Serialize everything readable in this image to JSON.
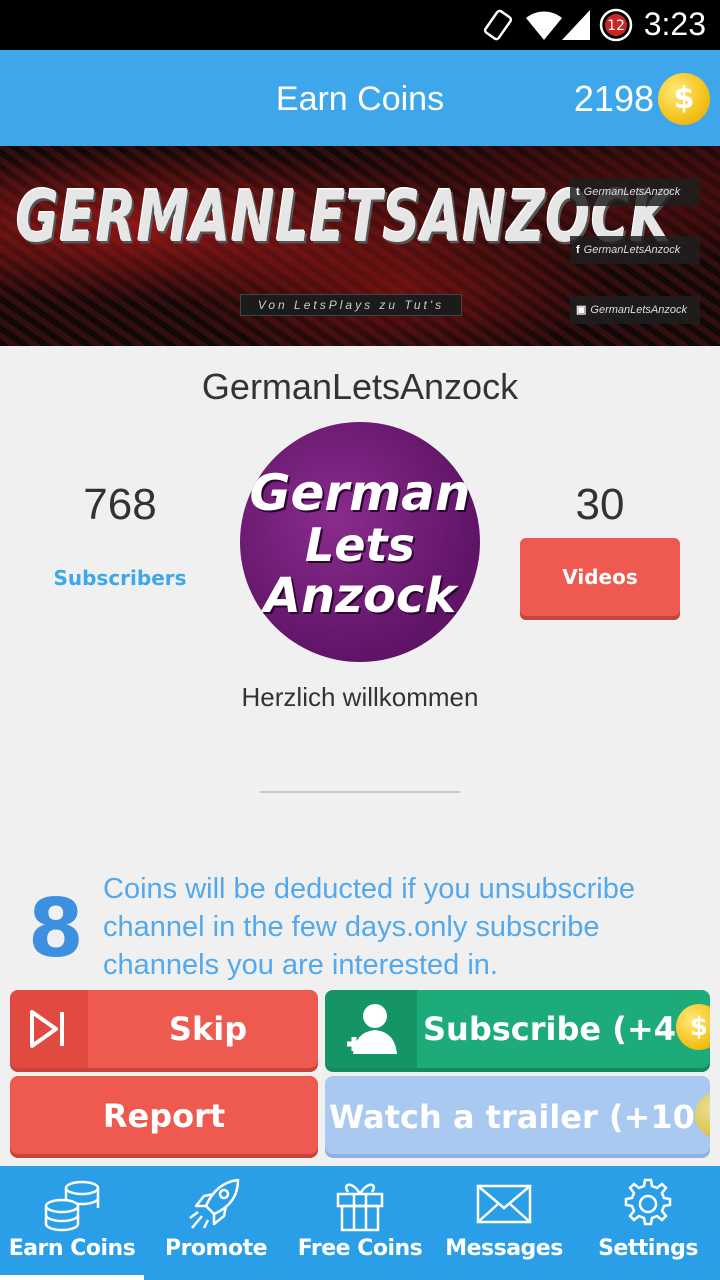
{
  "status_bar": {
    "time": "3:23",
    "notification_count": "12"
  },
  "app_bar": {
    "title": "Earn Coins",
    "coin_balance": "2198",
    "coin_symbol": "$"
  },
  "banner": {
    "logo_text": "GERMANLETSANZOCK",
    "tagline": "Von LetsPlays zu Tut's",
    "social": [
      {
        "icon": "twitter-icon",
        "glyph": "t",
        "handle": "GermanLetsAnzock"
      },
      {
        "icon": "facebook-icon",
        "glyph": "f",
        "handle": "GermanLetsAnzock"
      },
      {
        "icon": "twitch-icon",
        "glyph": "▣",
        "handle": "GermanLetsAnzock"
      }
    ]
  },
  "channel": {
    "name": "GermanLetsAnzock",
    "subscribers": "768",
    "subscribers_label": "Subscribers",
    "videos": "30",
    "videos_label": "Videos",
    "avatar_lines": [
      "German",
      "Lets",
      "Anzock"
    ],
    "description": "Herzlich willkommen"
  },
  "notice": {
    "count": "8",
    "text": "Coins will be deducted if you unsubscribe channel in the few days.only subscribe channels you are interested in."
  },
  "actions": {
    "skip": "Skip",
    "subscribe": "Subscribe (+4",
    "subscribe_close": ")",
    "report": "Report",
    "trailer": "Watch a trailer (+10",
    "trailer_close": ")"
  },
  "bottom_nav": [
    {
      "label": "Earn Coins",
      "icon": "coins-icon",
      "active": true
    },
    {
      "label": "Promote",
      "icon": "rocket-icon",
      "active": false
    },
    {
      "label": "Free Coins",
      "icon": "gift-icon",
      "active": false
    },
    {
      "label": "Messages",
      "icon": "envelope-icon",
      "active": false
    },
    {
      "label": "Settings",
      "icon": "gear-icon",
      "active": false
    }
  ],
  "colors": {
    "primary": "#3ea7eb",
    "nav": "#2b9ee8",
    "skip_red": "#ee5a50",
    "subscribe_green": "#1dab7a",
    "trailer_blue": "#a9c9f0",
    "coin_gold": "#f5c21a"
  }
}
